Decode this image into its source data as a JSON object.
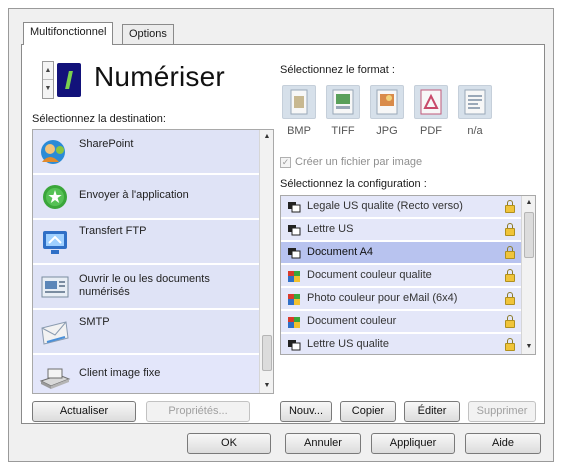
{
  "tabs": [
    {
      "label": "Multifonctionnel"
    },
    {
      "label": "Options"
    }
  ],
  "header": {
    "title": "Numériser",
    "icon": "scan-button-icon"
  },
  "destination": {
    "label": "Sélectionnez la destination:",
    "items": [
      {
        "label": "SharePoint",
        "icon": "sharepoint-icon"
      },
      {
        "label": "Envoyer à l'application",
        "icon": "send-to-application-icon"
      },
      {
        "label": "Transfert FTP",
        "icon": "ftp-transfer-icon"
      },
      {
        "label": "Ouvrir le ou les documents numérisés",
        "icon": "open-document-icon"
      },
      {
        "label": "SMTP",
        "icon": "smtp-mail-icon"
      },
      {
        "label": "Client image fixe",
        "icon": "still-image-client-icon"
      }
    ],
    "selected_index": 5,
    "refresh_label": "Actualiser",
    "properties_label": "Propriétés..."
  },
  "format": {
    "label": "Sélectionnez le format :",
    "items": [
      {
        "label": "BMP",
        "icon": "bmp-file-icon"
      },
      {
        "label": "TIFF",
        "icon": "tiff-file-icon"
      },
      {
        "label": "JPG",
        "icon": "jpg-file-icon"
      },
      {
        "label": "PDF",
        "icon": "pdf-file-icon"
      },
      {
        "label": "n/a",
        "icon": "text-file-icon"
      }
    ],
    "create_file_per_image": "Créer un fichier par image"
  },
  "configuration": {
    "label": "Sélectionnez la configuration :",
    "items": [
      {
        "label": "Legale US qualite (Recto verso)",
        "icon": "bw-config-icon"
      },
      {
        "label": "Lettre US",
        "icon": "bw-config-icon"
      },
      {
        "label": "Document A4",
        "icon": "bw-config-icon"
      },
      {
        "label": "Document couleur qualite",
        "icon": "color-config-icon"
      },
      {
        "label": "Photo couleur pour eMail (6x4)",
        "icon": "color-config-icon"
      },
      {
        "label": "Document couleur",
        "icon": "color-config-icon"
      },
      {
        "label": "Lettre US qualite",
        "icon": "bw-config-icon"
      }
    ],
    "selected_index": 2,
    "new_label": "Nouv...",
    "copy_label": "Copier",
    "edit_label": "Éditer",
    "delete_label": "Supprimer"
  },
  "footer": {
    "ok_label": "OK",
    "cancel_label": "Annuler",
    "apply_label": "Appliquer",
    "help_label": "Aide"
  },
  "colors": {
    "list_item_bg": "#dfe3f6",
    "selected_config_bg": "#b8c3ef",
    "window_bg": "#f0f0f0"
  }
}
